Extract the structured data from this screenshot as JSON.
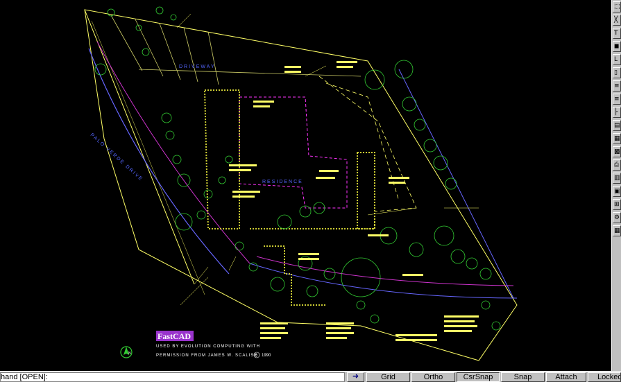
{
  "drawing": {
    "label_driveway": "DRIVEWAY",
    "label_residence": "RESIDENCE",
    "label_street": "PALO VERDE DRIVE",
    "logo_text": "FastCAD",
    "credit_line1": "USED BY EVOLUTION COMPUTING WITH",
    "credit_line2": "PERMISSION FROM JAMES W. SCALISE",
    "credit_year": "1990",
    "copyright_symbol": "©",
    "north_arrow_letter": "N"
  },
  "statusbar": {
    "command_text": "hand [OPEN]:",
    "arrow_icon": "right-arrow-icon",
    "buttons": [
      {
        "label": "Grid",
        "active": false
      },
      {
        "label": "Ortho",
        "active": false
      },
      {
        "label": "CsrSnap",
        "active": true
      },
      {
        "label": "Snap",
        "active": false
      },
      {
        "label": "Attach",
        "active": false
      },
      {
        "label": "Locked",
        "active": false
      }
    ]
  },
  "toolbar": {
    "items": [
      {
        "icon": "pointer-icon",
        "glyph": "⬚"
      },
      {
        "icon": "cross-icon",
        "glyph": "╳"
      },
      {
        "icon": "text-icon",
        "glyph": "T"
      },
      {
        "icon": "snap-icon",
        "glyph": "◼"
      },
      {
        "icon": "line-icon",
        "glyph": "L"
      },
      {
        "icon": "copy-icon",
        "glyph": "▯"
      },
      {
        "icon": "list-icon",
        "glyph": "≡"
      },
      {
        "icon": "list-icon-2",
        "glyph": "≡"
      },
      {
        "icon": "dimension-icon",
        "glyph": "├"
      },
      {
        "icon": "hatch-icon",
        "glyph": "▤"
      },
      {
        "icon": "layer-icon",
        "glyph": "▦"
      },
      {
        "icon": "color-icon",
        "glyph": "▩"
      },
      {
        "icon": "print-icon",
        "glyph": "⎙"
      },
      {
        "icon": "zoom-icon",
        "glyph": "▥"
      },
      {
        "icon": "view-icon",
        "glyph": "▣"
      },
      {
        "icon": "pan-icon",
        "glyph": "⊞"
      },
      {
        "icon": "settings-icon",
        "glyph": "⚙"
      },
      {
        "icon": "grid-icon",
        "glyph": "▦"
      }
    ]
  },
  "colors": {
    "background": "#000000",
    "property_line": "#ffff66",
    "vegetation": "#33cc33",
    "street": "#6666ff",
    "purple_line": "#cc33cc",
    "magenta": "#ff33ff",
    "logo_bg": "#9933cc"
  }
}
